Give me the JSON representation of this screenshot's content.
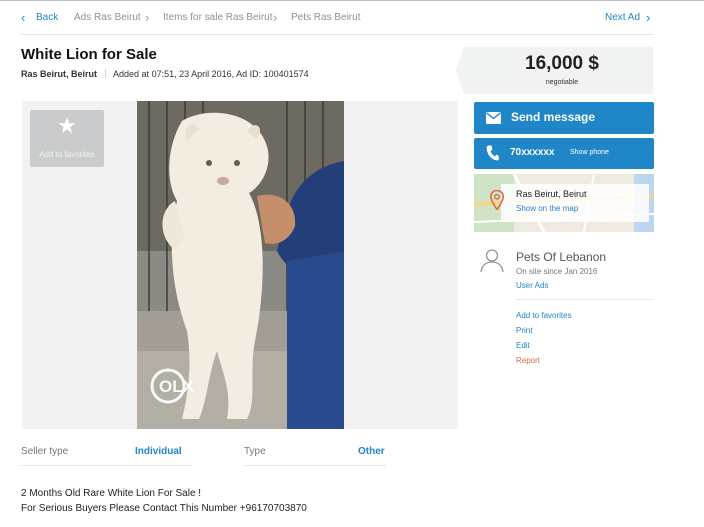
{
  "breadcrumb": {
    "back": "Back",
    "items": [
      "Ads Ras Beirut",
      "Items for sale Ras Beirut",
      "Pets Ras Beirut"
    ],
    "next": "Next Ad"
  },
  "ad": {
    "title": "White Lion for Sale",
    "location": "Ras Beirut, Beirut",
    "added": "Added at 07:51, 23 April 2016, Ad ID: 100401574",
    "price": "16,000 $",
    "price_note": "negotiable",
    "photo_watermark": "OLX"
  },
  "actions": {
    "add_to_favorites": "Add to favorites",
    "send_message": "Send message",
    "phone": "70xxxxxx",
    "show_phone": "Show phone"
  },
  "map": {
    "location": "Ras Beirut, Beirut",
    "show_on_map": "Show on the map"
  },
  "seller": {
    "name": "Pets Of Lebanon",
    "since": "On site since Jan 2016",
    "user_ads": "User Ads"
  },
  "side_links": {
    "add_to_favorites": "Add to favorites",
    "print": "Print",
    "edit": "Edit",
    "report": "Report"
  },
  "details": {
    "seller_type_label": "Seller type",
    "seller_type_value": "Individual",
    "type_label": "Type",
    "type_value": "Other"
  },
  "description": [
    "2 Months Old Rare White Lion For Sale !",
    "For Serious Buyers Please Contact This Number +96170703870"
  ],
  "colors": {
    "accent": "#1f86c7",
    "report": "#d9683f",
    "price_bg": "#f1f2f2"
  }
}
